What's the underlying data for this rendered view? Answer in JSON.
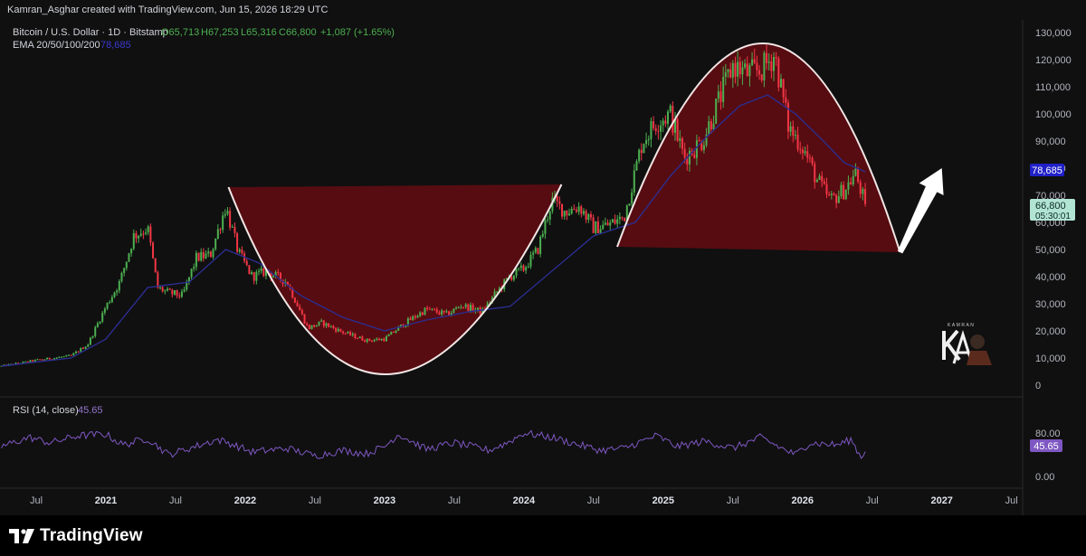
{
  "header": {
    "caption": "Kamran_Asghar created with TradingView.com, Jun 15, 2026 18:29 UTC"
  },
  "branding": {
    "footer_logo_text": "TradingView",
    "watermark_text": "KAMRAN"
  },
  "colors": {
    "background": "#101010",
    "up": "#4caf50",
    "down": "#f23645",
    "ema": "#2b2d8f",
    "rsi": "#7e57c2",
    "pattern_fill": "#5c0d12",
    "pattern_stroke": "#f2e6e6",
    "ema_badge": "#2121c9",
    "price_badge": "#b2e4d4"
  },
  "chart_data": [
    {
      "type": "candlestick",
      "title": "Bitcoin / U.S. Dollar · 1D · Bitstamp",
      "ohlc_legend": {
        "open": "O65,713",
        "high": "H67,253",
        "low": "L65,316",
        "close": "C66,800",
        "change": "+1,087 (+1.65%)"
      },
      "indicator_legend": {
        "name": "EMA 20/50/100/200",
        "value": "78,685"
      },
      "x_ticks": [
        "Jul",
        "2021",
        "Jul",
        "2022",
        "Jul",
        "2023",
        "Jul",
        "2024",
        "Jul",
        "2025",
        "Jul",
        "2026",
        "Jul",
        "2027",
        "Jul"
      ],
      "x_tick_dates": [
        2020.5,
        2021.0,
        2021.5,
        2022.0,
        2022.5,
        2023.0,
        2023.5,
        2024.0,
        2024.5,
        2025.0,
        2025.5,
        2026.0,
        2026.5,
        2027.0,
        2027.5
      ],
      "xlim": [
        2020.24,
        2027.58
      ],
      "y_ticks": [
        "130,000",
        "120,000",
        "110,000",
        "100,000",
        "90,000",
        "80,000",
        "70,000",
        "60,000",
        "50,000",
        "40,000",
        "30,000",
        "20,000",
        "10,000",
        "0"
      ],
      "ylim": [
        0,
        130000
      ],
      "price_series": {
        "dates": [
          2020.25,
          2020.5,
          2020.75,
          2020.87,
          2021.0,
          2021.1,
          2021.2,
          2021.3,
          2021.37,
          2021.45,
          2021.55,
          2021.65,
          2021.75,
          2021.86,
          2021.95,
          2022.05,
          2022.15,
          2022.3,
          2022.45,
          2022.55,
          2022.7,
          2022.87,
          2023.0,
          2023.15,
          2023.3,
          2023.45,
          2023.55,
          2023.7,
          2023.8,
          2023.9,
          2024.0,
          2024.1,
          2024.2,
          2024.3,
          2024.4,
          2024.5,
          2024.6,
          2024.72,
          2024.85,
          2024.95,
          2025.05,
          2025.15,
          2025.28,
          2025.4,
          2025.5,
          2025.6,
          2025.7,
          2025.8,
          2025.9,
          2026.0,
          2026.1,
          2026.2,
          2026.3,
          2026.38,
          2026.45
        ],
        "close": [
          7000,
          9200,
          10800,
          15000,
          29000,
          38000,
          55000,
          58000,
          36000,
          34000,
          33000,
          47000,
          48000,
          66000,
          49000,
          40000,
          42000,
          38000,
          21000,
          23000,
          19500,
          16500,
          17000,
          23000,
          28000,
          26000,
          29500,
          27000,
          34000,
          40000,
          43000,
          50000,
          68000,
          64000,
          66000,
          58000,
          59000,
          62000,
          90000,
          97000,
          100000,
          84000,
          90000,
          105000,
          118000,
          115000,
          116000,
          122000,
          95000,
          88000,
          76000,
          68000,
          72000,
          78000,
          66800
        ]
      },
      "ema_series": {
        "dates": [
          2020.25,
          2020.75,
          2021.0,
          2021.3,
          2021.6,
          2021.86,
          2022.1,
          2022.4,
          2022.7,
          2023.0,
          2023.3,
          2023.6,
          2023.9,
          2024.2,
          2024.5,
          2024.8,
          2025.05,
          2025.3,
          2025.55,
          2025.75,
          2025.95,
          2026.15,
          2026.3,
          2026.45
        ],
        "values": [
          7000,
          10000,
          17000,
          36000,
          38000,
          50000,
          45000,
          33000,
          25000,
          20000,
          24000,
          27000,
          29000,
          42000,
          55000,
          60000,
          77000,
          91000,
          103000,
          107000,
          100000,
          90000,
          82000,
          78685
        ]
      },
      "annotations": [
        {
          "type": "cup",
          "rim_left": {
            "x": 2021.88,
            "y": 73000
          },
          "rim_right": {
            "x": 2024.27,
            "y": 74000
          },
          "bottom": {
            "x": 2023.01,
            "y": 4000
          }
        },
        {
          "type": "inverted_cup",
          "base_left": {
            "x": 2024.67,
            "y": 51000
          },
          "base_right": {
            "x": 2026.7,
            "y": 49000
          },
          "top": {
            "x": 2025.72,
            "y": 126000
          }
        },
        {
          "type": "arrow",
          "from": {
            "x": 2026.7,
            "y": 49000
          },
          "to": {
            "x": 2027.0,
            "y": 80000
          }
        }
      ],
      "axis_badges": {
        "ema_value": "78,685",
        "price_value": "66,800",
        "countdown": "05:30:01"
      }
    },
    {
      "type": "line",
      "title": "RSI (14, close)",
      "last_value": "45.65",
      "y_ticks": [
        "80.00",
        "0.00"
      ],
      "ylim": [
        0,
        100
      ],
      "dates": [
        2020.25,
        2020.45,
        2020.6,
        2020.8,
        2021.0,
        2021.12,
        2021.3,
        2021.45,
        2021.6,
        2021.8,
        2021.88,
        2022.05,
        2022.3,
        2022.5,
        2022.7,
        2022.87,
        2023.0,
        2023.1,
        2023.3,
        2023.5,
        2023.75,
        2023.88,
        2024.0,
        2024.2,
        2024.4,
        2024.55,
        2024.72,
        2024.85,
        2024.95,
        2025.1,
        2025.3,
        2025.5,
        2025.7,
        2025.85,
        2025.95,
        2026.05,
        2026.25,
        2026.35,
        2026.42,
        2026.45
      ],
      "values": [
        55,
        72,
        62,
        75,
        78,
        58,
        70,
        40,
        52,
        68,
        62,
        45,
        52,
        38,
        48,
        42,
        55,
        78,
        50,
        62,
        48,
        62,
        80,
        72,
        58,
        48,
        52,
        65,
        75,
        55,
        65,
        52,
        72,
        52,
        40,
        62,
        58,
        68,
        35,
        45.65
      ]
    }
  ]
}
